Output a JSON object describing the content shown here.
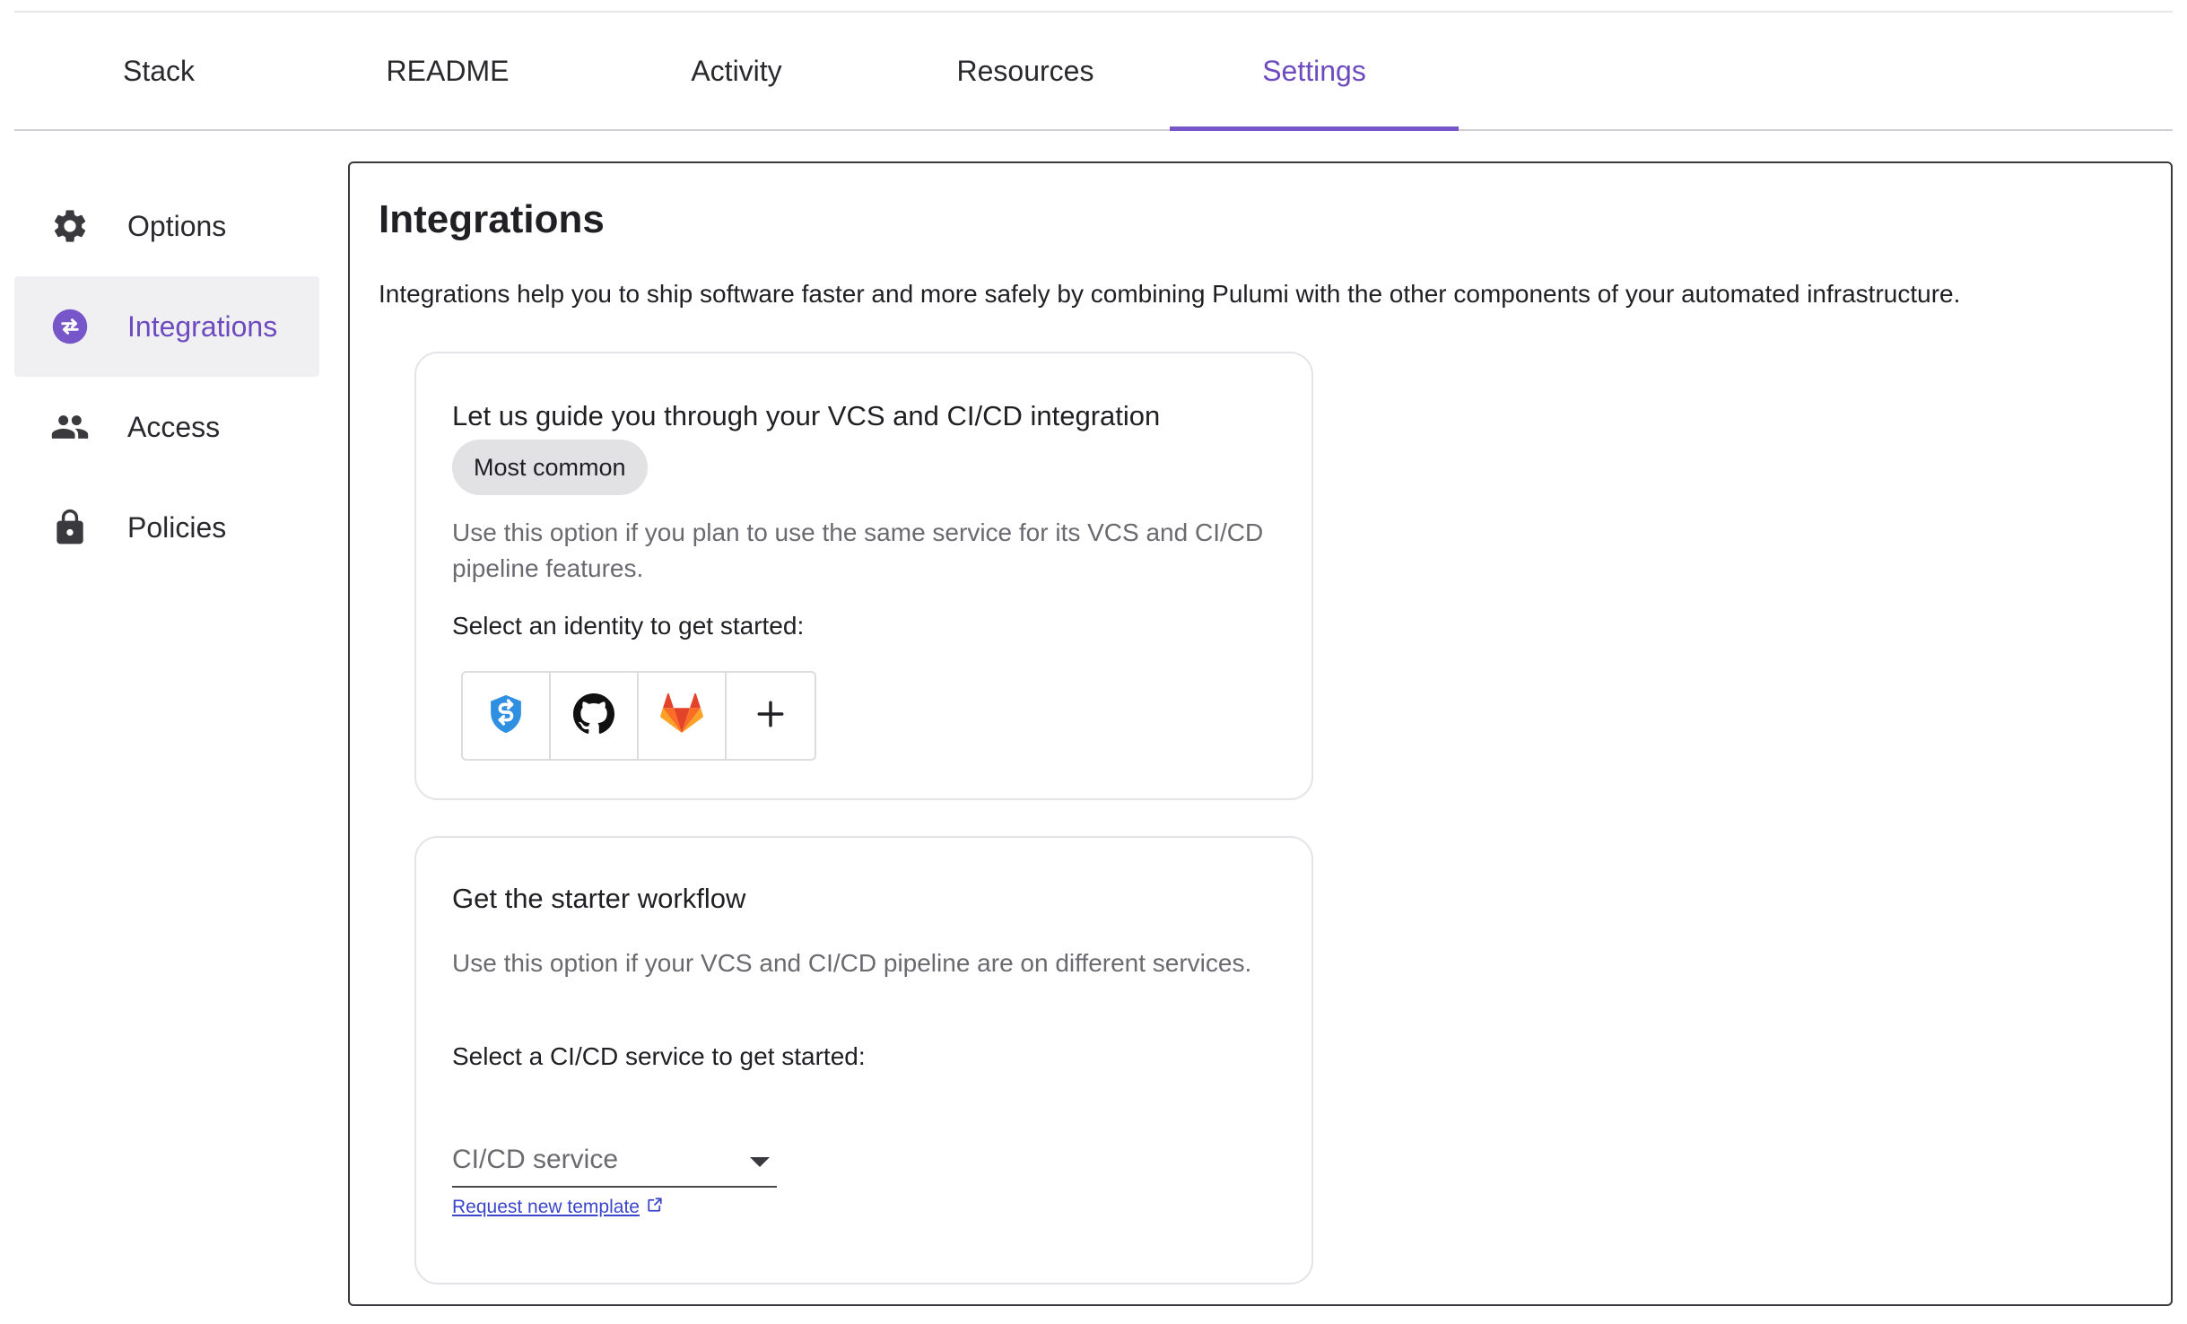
{
  "tabs": [
    {
      "label": "Stack"
    },
    {
      "label": "README"
    },
    {
      "label": "Activity"
    },
    {
      "label": "Resources"
    },
    {
      "label": "Settings",
      "active": true
    }
  ],
  "sidebar": {
    "items": [
      {
        "label": "Options",
        "icon": "gear-icon"
      },
      {
        "label": "Integrations",
        "icon": "integrations-icon",
        "active": true
      },
      {
        "label": "Access",
        "icon": "people-icon"
      },
      {
        "label": "Policies",
        "icon": "lock-icon"
      }
    ]
  },
  "main": {
    "title": "Integrations",
    "description": "Integrations help you to ship software faster and more safely by combining Pulumi with the other components of your automated infrastructure.",
    "guide_card": {
      "title": "Let us guide you through your VCS and CI/CD integration",
      "badge": "Most common",
      "description": "Use this option if you plan to use the same service for its VCS and CI/CD pipeline features.",
      "prompt": "Select an identity to get started:",
      "identities": [
        "azure-devops-icon",
        "github-icon",
        "gitlab-icon",
        "plus-icon"
      ]
    },
    "starter_card": {
      "title": "Get the starter workflow",
      "description": "Use this option if your VCS and CI/CD pipeline are on different services.",
      "prompt": "Select a CI/CD service to get started:",
      "select_placeholder": "CI/CD service",
      "link_label": "Request new template"
    }
  },
  "colors": {
    "accent": "#7756c9",
    "accent_text": "#6d4bbf",
    "link": "#3b46c9",
    "muted_text": "#6a6a70",
    "border": "#e4e4e8"
  }
}
